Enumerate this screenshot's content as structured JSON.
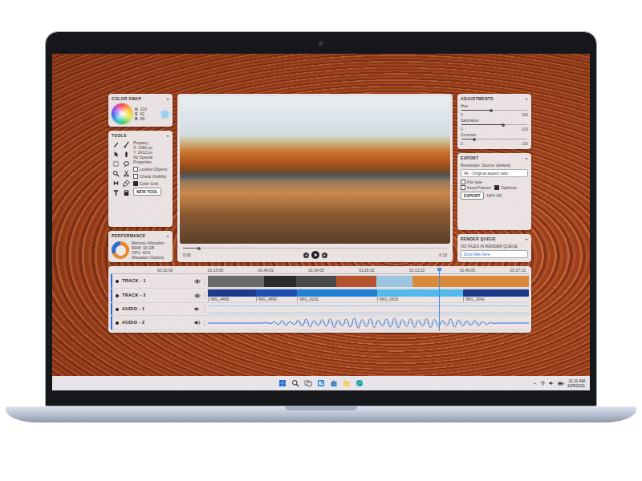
{
  "color_swap": {
    "title": "COLOR SWAP",
    "values": [
      {
        "label": "H",
        "value": "210"
      },
      {
        "label": "S",
        "value": "42"
      },
      {
        "label": "B",
        "value": "88"
      }
    ],
    "color": "#9fd0ee"
  },
  "tools": {
    "title": "TOOLS",
    "properties": [
      "Property",
      "X: 1082 px",
      "Y: 2412 px",
      "No Special Properties"
    ],
    "options": [
      {
        "label": "Locked Objects",
        "checked": false
      },
      {
        "label": "Check Visibility",
        "checked": false
      },
      {
        "label": "Color Grid",
        "checked": true
      }
    ],
    "button": "NEW TOOL"
  },
  "performance": {
    "title": "PERFORMANCE",
    "lines": [
      "Memory Allocation",
      "RAM: 16 GB",
      "CPU: 42%",
      "Allocation Options"
    ],
    "level": 0.68
  },
  "player": {
    "elapsed": "0:00",
    "remaining": "0:13",
    "level": 0.06,
    "playing": false
  },
  "adjustments": {
    "title": "ADJUSTMENTS",
    "sliders": [
      {
        "label": "Hue",
        "min": "0",
        "max": "100",
        "level": 0.45
      },
      {
        "label": "Saturation",
        "min": "0",
        "max": "100",
        "level": 0.63
      },
      {
        "label": "Contrast",
        "min": "0",
        "max": "100",
        "level": 0.2
      }
    ]
  },
  "export": {
    "title": "EXPORT",
    "label": "Resolution: Source (default)",
    "field": "4K - Original aspect ratio",
    "options": [
      {
        "label": "File type",
        "checked": false
      },
      {
        "label": "Keep Frames",
        "checked": false
      },
      {
        "label": "Optimize",
        "checked": true
      }
    ],
    "button": "EXPORT",
    "note": "MP4 HD"
  },
  "render_queue": {
    "title": "RENDER QUEUE",
    "message": "NO FILES IN RENDER QUEUE",
    "field": "Drop files here"
  },
  "timeline": {
    "ticks": [
      "00:12:00",
      "02:13:00",
      "01:40:02",
      "01:34:05",
      "01:26:32",
      "01:12:22",
      "01:40:05",
      "00:27:12"
    ],
    "playhead": 0.72,
    "tracks": [
      {
        "name": "TRACK - 1",
        "kind": "thumbs",
        "clips": [
          {
            "color": "#6b6b6b"
          },
          {
            "color": "#2c2c2c"
          },
          {
            "color": "#4a4a4a"
          },
          {
            "color": "#b5532e"
          },
          {
            "color": "#9cc6e0"
          },
          {
            "color": "#d98a3a"
          }
        ]
      },
      {
        "name": "TRACK - 2",
        "kind": "clips",
        "clips": [
          {
            "label": "IMG_4456",
            "color": "#1b3a8c"
          },
          {
            "label": "IMG_4892",
            "color": "#1d4fb2"
          },
          {
            "label": "IMG_6231",
            "color": "#1f80d6"
          },
          {
            "label": "IMG_0915",
            "color": "#52b9ea"
          },
          {
            "label": "IMG_2041",
            "color": "#1b3a8c"
          }
        ]
      },
      {
        "name": "AUDIO - 1",
        "kind": "empty",
        "level": 0.3
      },
      {
        "name": "AUDIO - 2",
        "kind": "waveform",
        "level": 0.8,
        "waveform": [
          0,
          0,
          0,
          0,
          0,
          0,
          0,
          0.1,
          0.3,
          0.5,
          0.3,
          0.6,
          0.8,
          0.5,
          0.7,
          0.9,
          0.6,
          0.8,
          1,
          0.7,
          0.9,
          0.6,
          0.8,
          0.95,
          0.7,
          0.85,
          0.6,
          0.9,
          0.7,
          0.5,
          0.8,
          0.6,
          0.4,
          0.5,
          0.3,
          0.1,
          0,
          0,
          0,
          0
        ]
      }
    ]
  },
  "taskbar": {
    "time": "11:11 AM",
    "date": "10/5/2021"
  }
}
